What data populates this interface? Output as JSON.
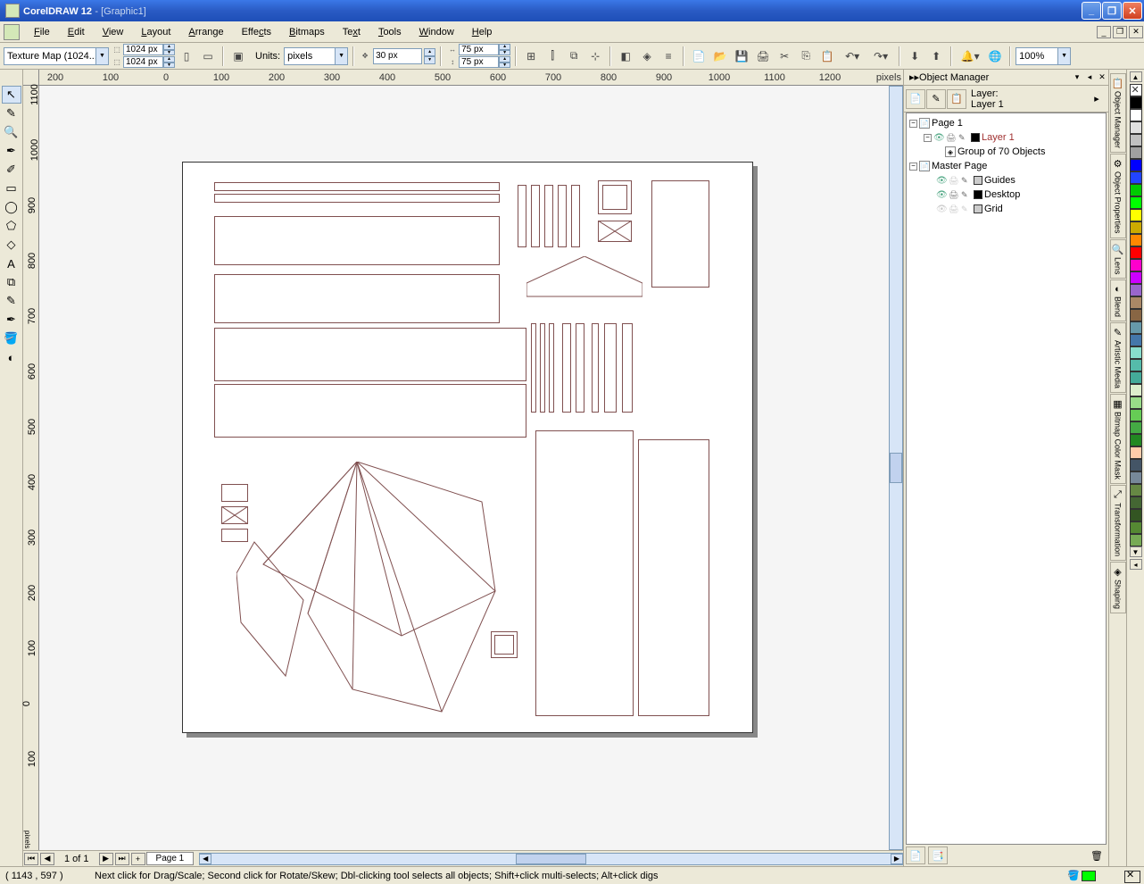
{
  "app": {
    "name": "CorelDRAW 12",
    "document": "[Graphic1]"
  },
  "menus": [
    "File",
    "Edit",
    "View",
    "Layout",
    "Arrange",
    "Effects",
    "Bitmaps",
    "Text",
    "Tools",
    "Window",
    "Help"
  ],
  "propbar": {
    "paper_preset": "Texture Map (1024...",
    "width": "1024 px",
    "height": "1024 px",
    "units_label": "Units:",
    "units": "pixels",
    "nudge": "30 px",
    "dup_x": "75 px",
    "dup_y": "75 px",
    "zoom": "100%"
  },
  "ruler": {
    "h_ticks": [
      200,
      100,
      0,
      100,
      200,
      300,
      400,
      500,
      600,
      700,
      800,
      900,
      1000,
      1100,
      1200
    ],
    "v_ticks": [
      1100,
      1000,
      900,
      800,
      700,
      600,
      500,
      400,
      300,
      200,
      100,
      0,
      100
    ],
    "unit": "pixels"
  },
  "pagenav": {
    "info": "1 of 1",
    "tab": "Page 1"
  },
  "docker": {
    "title": "Object Manager",
    "layer_lbl": "Layer:",
    "layer_name": "Layer 1",
    "tree": {
      "page": "Page 1",
      "layer1": "Layer 1",
      "group": "Group of 70 Objects",
      "master": "Master Page",
      "guides": "Guides",
      "desktop": "Desktop",
      "grid": "Grid"
    }
  },
  "tabs": [
    "Object Manager",
    "Object Properties",
    "Lens",
    "Blend",
    "Artistic Media",
    "Bitmap Color Mask",
    "Transformation",
    "Shaping"
  ],
  "palette": [
    "#000000",
    "#ffffff",
    "#e0e0e0",
    "#c0c0c0",
    "#a0a0a0",
    "#0000ff",
    "#2244ff",
    "#00cc00",
    "#00ff00",
    "#ffff00",
    "#ccaa00",
    "#ff8800",
    "#ff0000",
    "#ff00cc",
    "#cc00ff",
    "#9966cc",
    "#aa8866",
    "#886644",
    "#6699aa",
    "#4477aa",
    "#88ddcc",
    "#55bbaa",
    "#44aa99",
    "#ddeecc",
    "#99dd88",
    "#66cc55",
    "#44aa44",
    "#228822",
    "#ffccaa",
    "#445566",
    "#778899",
    "#668844",
    "#446633",
    "#335522",
    "#558833",
    "#77aa55"
  ],
  "status": {
    "coords": "( 1143 , 597   )",
    "msg": "Next click for Drag/Scale; Second click for Rotate/Skew; Dbl-clicking tool selects all objects; Shift+click multi-selects; Alt+click digs",
    "fill": "#00ff00"
  }
}
